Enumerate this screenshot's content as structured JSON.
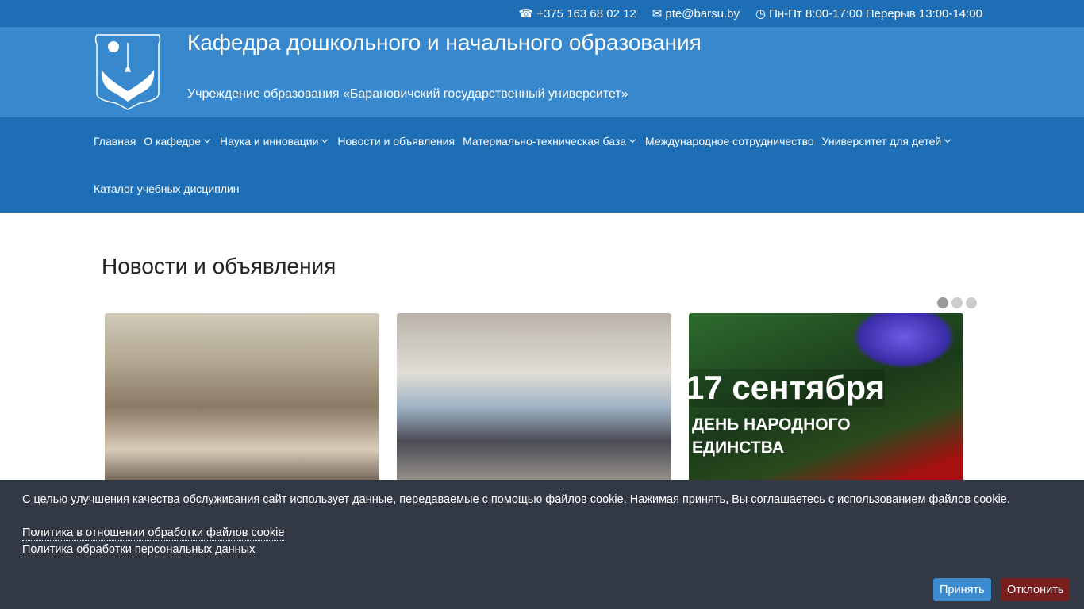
{
  "topbar": {
    "phone": "+375 163 68 02 12",
    "email": "pte@barsu.by",
    "hours": "Пн-Пт 8:00-17:00 Перерыв 13:00-14:00"
  },
  "header": {
    "title": "Кафедра дошкольного и начального образования",
    "subtitle": "Учреждение образования «Барановичский государственный университет»"
  },
  "nav": {
    "items": [
      {
        "label": "Главная",
        "dropdown": false
      },
      {
        "label": "О кафедре",
        "dropdown": true
      },
      {
        "label": "Наука и инновации",
        "dropdown": true
      },
      {
        "label": "Новости и объявления",
        "dropdown": false
      },
      {
        "label": "Материально-техническая база",
        "dropdown": true
      },
      {
        "label": "Международное сотрудничество",
        "dropdown": false
      },
      {
        "label": "Университет для детей",
        "dropdown": true
      }
    ],
    "row2": "Каталог учебных дисциплин"
  },
  "news": {
    "heading": "Новости и объявления",
    "slider_pages": 3,
    "active_page": 1,
    "card3": {
      "line1": "17 сентября",
      "line2": "ДЕНЬ НАРОДНОГО",
      "line3": "ЕДИНСТВА"
    }
  },
  "cookie": {
    "text": "С целью улучшения качества обслуживания сайт использует данные, передаваемые с помощью файлов cookie. Нажимая принять, Вы соглашаетесь с использованием файлов cookie.",
    "link1": "Политика в отношении обработки файлов cookie",
    "link2": "Политика обработки персональных данных",
    "accept": "Принять",
    "decline": "Отклонить",
    "accept_color": "#3a8bd0",
    "decline_color": "#7a1d1d"
  }
}
